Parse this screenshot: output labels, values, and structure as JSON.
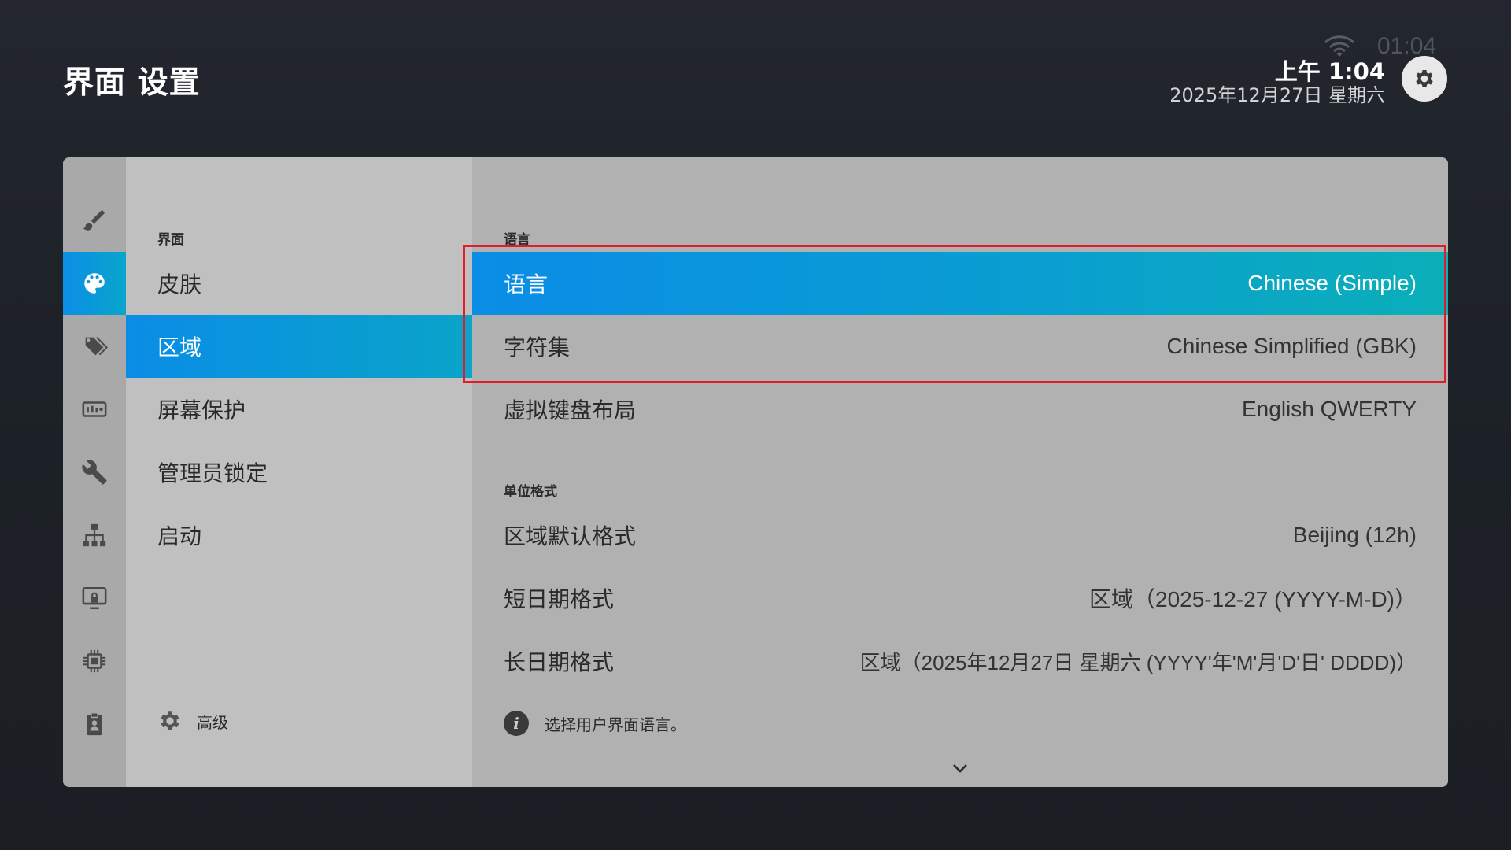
{
  "header": {
    "title": "界面 设置",
    "ghost_time": "01:04",
    "time": "上午 1:04",
    "date": "2025年12月27日 星期六"
  },
  "rail": {
    "icons": [
      "brush-icon",
      "palette-icon",
      "tags-icon",
      "display-settings-icon",
      "wrench-icon",
      "network-icon",
      "screen-lock-icon",
      "chip-icon",
      "badge-icon"
    ],
    "active_index": 1
  },
  "subnav": {
    "section_label": "界面",
    "items": [
      {
        "label": "皮肤",
        "active": false
      },
      {
        "label": "区域",
        "active": true
      },
      {
        "label": "屏幕保护",
        "active": false
      },
      {
        "label": "管理员锁定",
        "active": false
      },
      {
        "label": "启动",
        "active": false
      }
    ],
    "advanced_label": "高级"
  },
  "content": {
    "section1_label": "语言",
    "rows1": [
      {
        "label": "语言",
        "value": "Chinese (Simple)",
        "active": true
      },
      {
        "label": "字符集",
        "value": "Chinese Simplified (GBK)",
        "active": false
      },
      {
        "label": "虚拟键盘布局",
        "value": "English QWERTY",
        "active": false
      }
    ],
    "section2_label": "单位格式",
    "rows2": [
      {
        "label": "区域默认格式",
        "value": "Beijing (12h)"
      },
      {
        "label": "短日期格式",
        "value": "区域（2025-12-27 (YYYY-M-D)）"
      },
      {
        "label": "长日期格式",
        "value": "区域（2025年12月27日 星期六 (YYYY'年'M'月'D'日' DDDD)）"
      }
    ],
    "info_text": "选择用户界面语言。"
  },
  "colors": {
    "accent_start": "#0a8de6",
    "accent_end": "#0aafb8",
    "highlight_border": "#e01e2b"
  }
}
